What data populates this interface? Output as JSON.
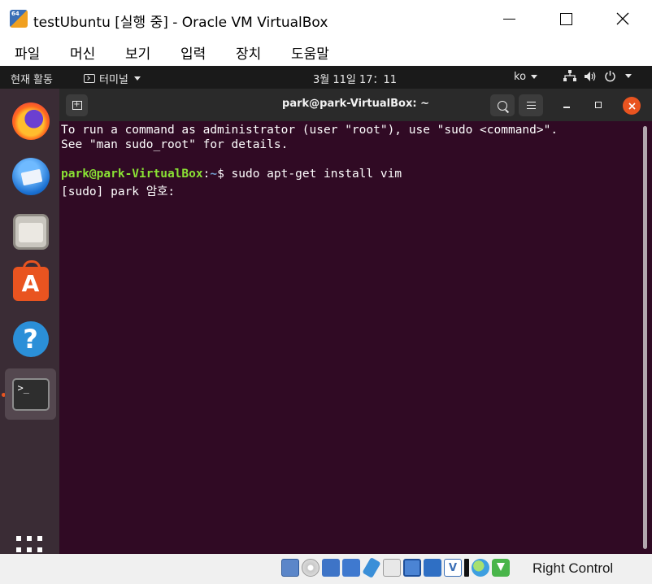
{
  "host_window": {
    "title": "testUbuntu [실행 중] - Oracle VM VirtualBox",
    "app_icon_label": "64"
  },
  "menu": [
    "파일",
    "머신",
    "보기",
    "입력",
    "장치",
    "도움말"
  ],
  "ubuntu_panel": {
    "activities": "현재 활동",
    "app_name": "터미널",
    "clock": "3월 11일  17：11",
    "input_method": "ko",
    "tray_icons": [
      "network-icon",
      "volume-icon",
      "power-icon"
    ]
  },
  "dock": {
    "apps": [
      "firefox-icon",
      "thunderbird-icon",
      "files-icon",
      "software-store-icon",
      "help-icon",
      "terminal-icon"
    ],
    "running_app": "terminal-icon",
    "terminal_glyph": ">_",
    "store_glyph": "A",
    "help_glyph": "?"
  },
  "terminal": {
    "title": "park@park-VirtualBox: ~",
    "lines": {
      "l1": "To run a command as administrator (user \"root\"), use \"sudo <command>\".",
      "l2": "See \"man sudo_root\" for details.",
      "prompt_user": "park@park-VirtualBox",
      "prompt_sep": ":",
      "prompt_path": "~",
      "prompt_cmd": "$ sudo apt-get install vim",
      "l4": "[sudo] park 암호: "
    },
    "colors": {
      "background": "#300a24",
      "prompt_user": "#8ae234",
      "prompt_path": "#729fcf",
      "close_button": "#e95420"
    }
  },
  "statusbar": {
    "icons": [
      "hard-disk-icon",
      "optical-drive-icon",
      "audio-icon",
      "network-icon",
      "usb-icon",
      "shared-folders-icon",
      "display-icon",
      "recording-icon",
      "virtualization-icon",
      "mouse-integration-icon",
      "globe-icon",
      "keyboard-capture-icon"
    ],
    "host_key": "Right Control"
  }
}
